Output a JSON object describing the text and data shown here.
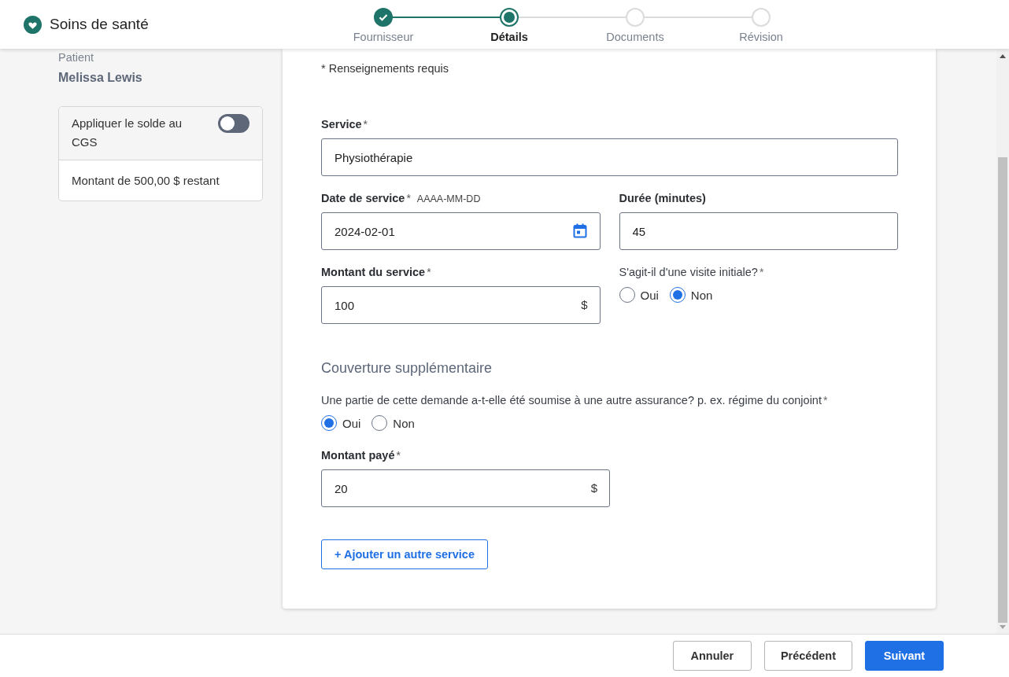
{
  "app": {
    "title": "Soins de santé"
  },
  "stepper": [
    {
      "label": "Fournisseur",
      "done": true,
      "selected": false
    },
    {
      "label": "Détails",
      "done": false,
      "selected": true
    },
    {
      "label": "Documents",
      "done": false,
      "selected": false
    },
    {
      "label": "Révision",
      "done": false,
      "selected": false
    }
  ],
  "patient": {
    "label": "Patient",
    "name": "Melissa Lewis"
  },
  "balance_card": {
    "toggle_label": "Appliquer le solde au CGS",
    "on": false,
    "remaining": "Montant de 500,00 $ restant"
  },
  "form": {
    "required_note": "* Renseignements requis",
    "rows": [
      [
        {
          "kind": "text",
          "label": "Service",
          "asterisk": "*",
          "value": "Physiothérapie"
        }
      ],
      [
        {
          "kind": "date",
          "label": "Date de service",
          "asterisk": "*",
          "hint": "AAAA-MM-DD",
          "value": "2024-02-01"
        },
        {
          "kind": "text",
          "label": "Durée (minutes)",
          "value": "45"
        }
      ],
      [
        {
          "kind": "amount",
          "label": "Montant du service",
          "asterisk": "*",
          "value": "100",
          "suffix": "$"
        },
        {
          "kind": "radio",
          "label": "S'agit-il d'une visite initiale?",
          "asterisk": "*",
          "options": [
            {
              "label": "Oui",
              "selected": false
            },
            {
              "label": "Non",
              "selected": true
            }
          ]
        }
      ]
    ],
    "coverage": {
      "heading": "Couverture supplémentaire",
      "question": {
        "kind": "radio",
        "label": "Une partie de cette demande a-t-elle été soumise à une autre assurance? p. ex. régime du conjoint",
        "asterisk": "*",
        "options": [
          {
            "label": "Oui",
            "selected": true
          },
          {
            "label": "Non",
            "selected": false
          }
        ]
      },
      "paid": {
        "kind": "amount",
        "label": "Montant payé",
        "asterisk": "*",
        "value": "20",
        "suffix": "$"
      }
    },
    "add_button": "+ Ajouter un autre service"
  },
  "footer": {
    "buttons": [
      {
        "label": "Annuler",
        "kind": "secondary"
      },
      {
        "label": "Précédent",
        "kind": "secondary"
      },
      {
        "label": "Suivant",
        "kind": "primary"
      }
    ]
  }
}
